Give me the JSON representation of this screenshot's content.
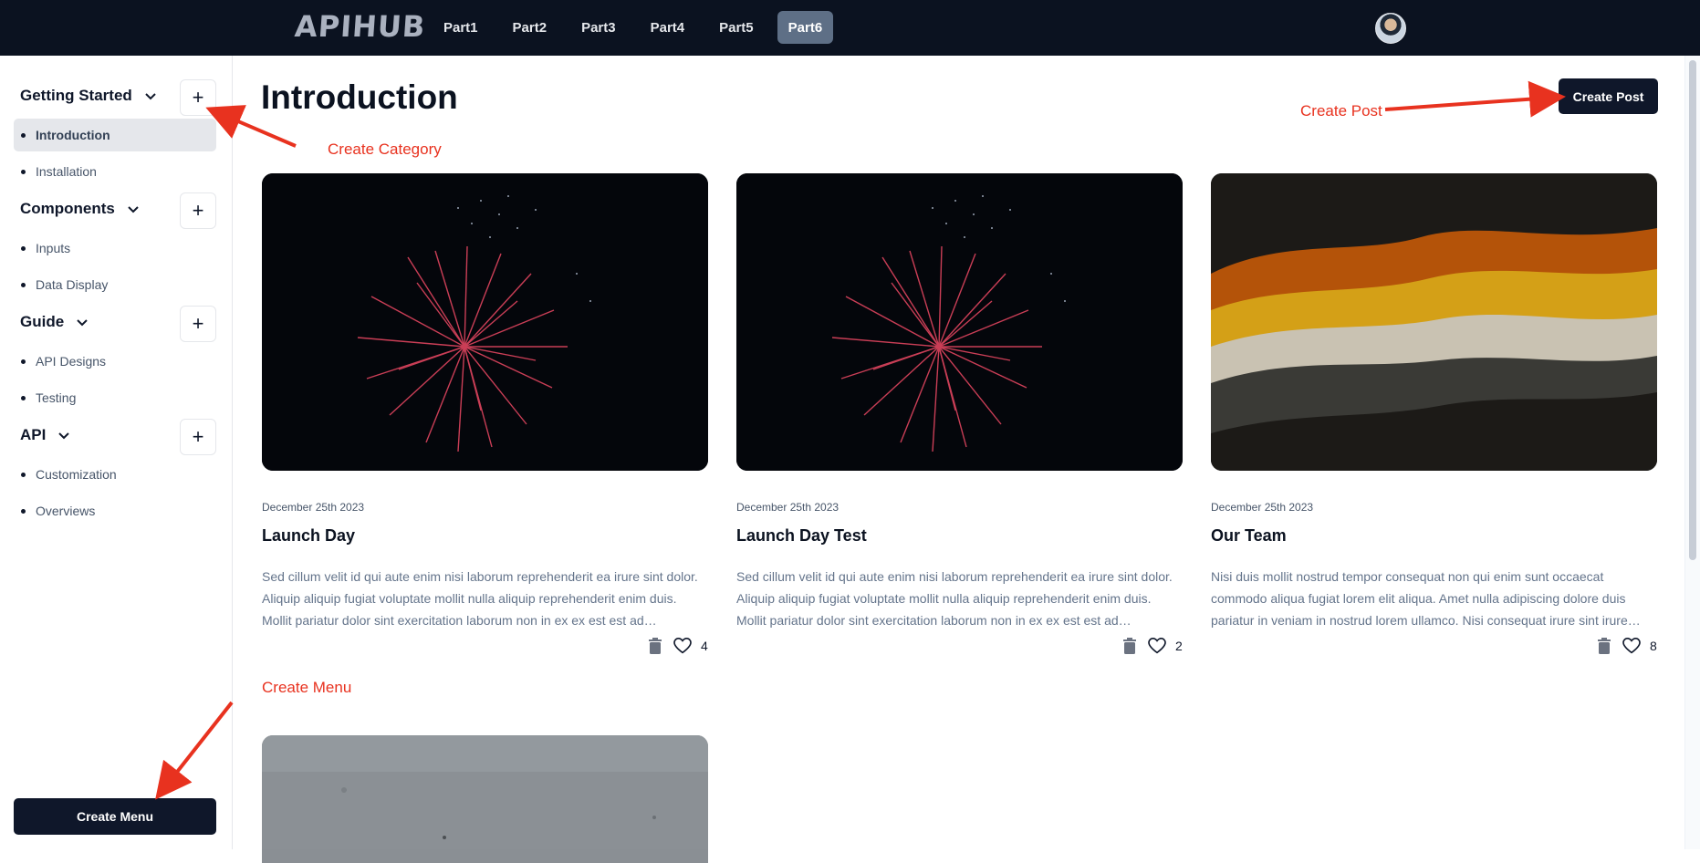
{
  "header": {
    "logo": "APIHUB",
    "nav": [
      "Part1",
      "Part2",
      "Part3",
      "Part4",
      "Part5",
      "Part6"
    ],
    "active_nav": "Part6"
  },
  "sidebar": {
    "categories": [
      {
        "title": "Getting Started",
        "items": [
          "Introduction",
          "Installation"
        ]
      },
      {
        "title": "Components",
        "items": [
          "Inputs",
          "Data Display"
        ]
      },
      {
        "title": "Guide",
        "items": [
          "API Designs",
          "Testing"
        ]
      },
      {
        "title": "API",
        "items": [
          "Customization",
          "Overviews"
        ]
      }
    ],
    "active_item": "Introduction",
    "create_menu_label": "Create Menu"
  },
  "main": {
    "title": "Introduction",
    "create_post_label": "Create Post",
    "cards": [
      {
        "date": "December 25th 2023",
        "title": "Launch Day",
        "text": "Sed cillum velit id qui aute enim nisi laborum reprehenderit ea irure sint dolor. Aliquip aliquip fugiat voluptate mollit nulla aliquip reprehenderit enim duis. Mollit pariatur dolor sint exercitation laborum non in ex ex est est ad…",
        "likes": "4"
      },
      {
        "date": "December 25th 2023",
        "title": "Launch Day Test",
        "text": "Sed cillum velit id qui aute enim nisi laborum reprehenderit ea irure sint dolor. Aliquip aliquip fugiat voluptate mollit nulla aliquip reprehenderit enim duis. Mollit pariatur dolor sint exercitation laborum non in ex ex est est ad…",
        "likes": "2"
      },
      {
        "date": "December 25th 2023",
        "title": "Our Team",
        "text": "Nisi duis mollit nostrud tempor consequat non qui enim sunt occaecat commodo aliqua fugiat lorem elit aliqua. Amet nulla adipiscing dolore duis pariatur in veniam in nostrud lorem ullamco. Nisi consequat irure sint irure…",
        "likes": "8"
      }
    ]
  },
  "annotations": {
    "create_category": "Create Category",
    "create_post": "Create Post",
    "create_menu": "Create Menu",
    "color": "#e8321f"
  },
  "icons": [
    "chevron-down-icon",
    "plus-icon",
    "trash-icon",
    "heart-icon",
    "avatar"
  ],
  "colors": {
    "nav_bg": "#0b1220",
    "active_nav": "#5e6f86",
    "primary_button": "#0f172a"
  }
}
